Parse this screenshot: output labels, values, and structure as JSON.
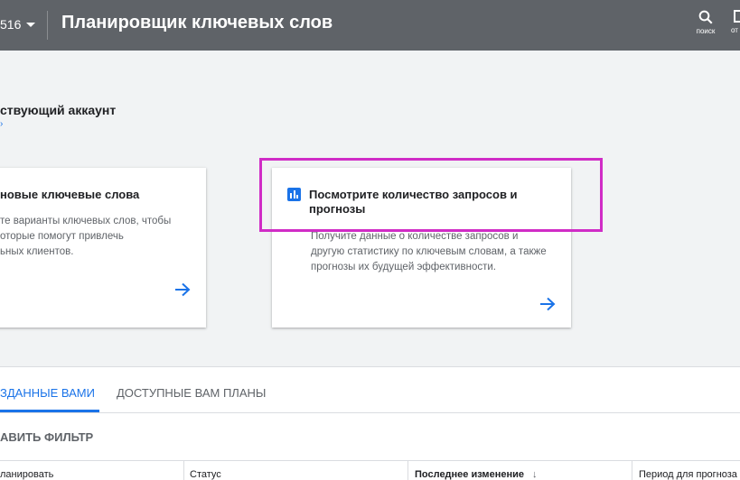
{
  "header": {
    "account_fragment": "516",
    "title": "Планировщик ключевых слов",
    "search_label": "поиск",
    "second_label_fragment": "от"
  },
  "section": {
    "heading_fragment": "ствующий аккаунт"
  },
  "cards": [
    {
      "title_fragment": "новые ключевые слова",
      "description": [
        "те варианты ключевых слов, чтобы",
        "оторые помогут привлечь",
        "ьных клиентов."
      ],
      "arrow_icon": "arrow-right-icon"
    },
    {
      "icon": "bar-chart-icon",
      "title": [
        "Посмотрите количество запросов и",
        "прогнозы"
      ],
      "description": [
        "Получите данные о количестве запросов и",
        "другую статистику по ключевым словам, а также",
        "прогнозы их будущей эффективности."
      ],
      "arrow_icon": "arrow-right-icon"
    }
  ],
  "tabs": [
    {
      "label": "ЗДАННЫЕ ВАМИ",
      "active": true
    },
    {
      "label": "ДОСТУПНЫЕ ВАМ ПЛАНЫ",
      "active": false
    }
  ],
  "filter": {
    "label": "АВИТЬ ФИЛЬТР"
  },
  "table": {
    "columns": [
      "ланировать",
      "Статус",
      "Последнее изменение",
      "Период для прогноза"
    ],
    "sort_icon": "arrow-down-icon"
  },
  "colors": {
    "topbar": "#5f6368",
    "accent": "#1a73e8",
    "highlight": "#d02cc6"
  }
}
